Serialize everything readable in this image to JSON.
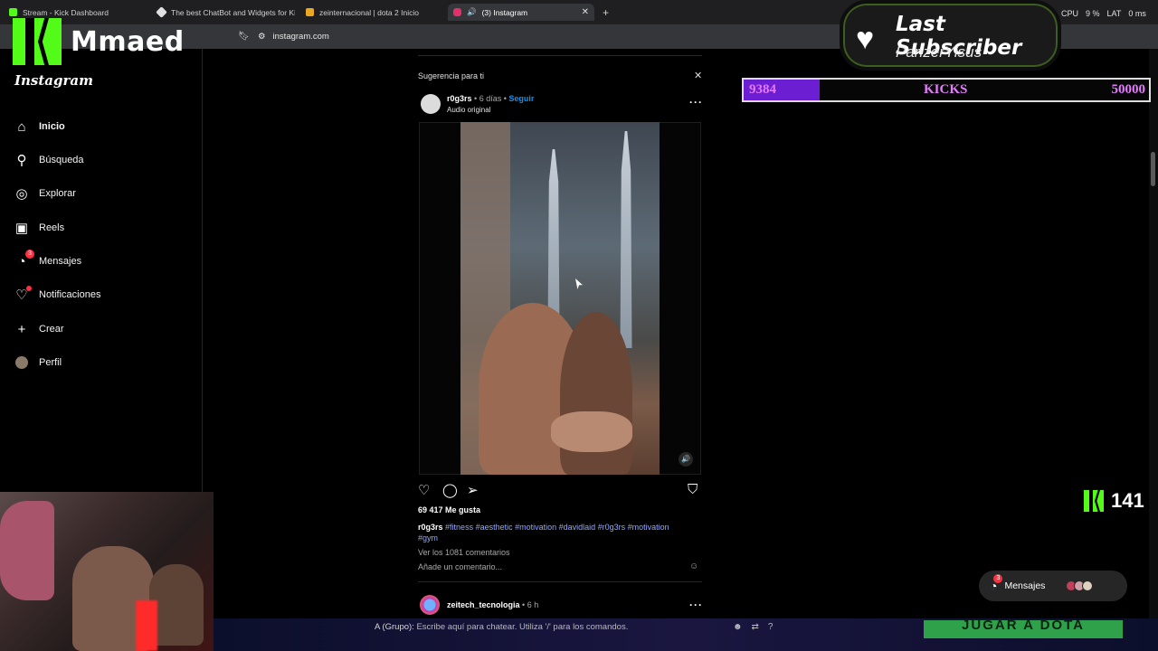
{
  "browser": {
    "tabs": [
      {
        "title": "Stream - Kick Dashboard",
        "active": false
      },
      {
        "title": "The best ChatBot and Widgets for Ki",
        "active": false
      },
      {
        "title": "zeinternacional | dota 2 Inicio",
        "active": false
      },
      {
        "title": "(3) Instagram",
        "active": true
      }
    ],
    "url": "instagram.com",
    "sys": {
      "cpu_label": "CPU",
      "cpu_value": "9 %",
      "lat_label": "LAT",
      "lat_value": "0 ms"
    }
  },
  "overlay": {
    "streamer_name": "Mmaed",
    "last_subscriber_title": "Last Subscriber",
    "last_subscriber_name": "PanzerYisus",
    "goal": {
      "current": "9384",
      "label": "KICKS",
      "target": "50000",
      "fill_fraction": 0.1877
    },
    "kick_count": "141",
    "chat_prefix": "A (Grupo):",
    "chat_placeholder": "Escribe aquí para chatear. Utiliza '/' para los comandos.",
    "banner_text": "JUGAR A DOTA",
    "brand_color": "#53fc18",
    "goal_color": "#6c1fd2"
  },
  "instagram": {
    "logo": "Instagram",
    "nav": [
      {
        "label": "Inicio",
        "icon": "home-icon",
        "bold": true
      },
      {
        "label": "Búsqueda",
        "icon": "search-icon"
      },
      {
        "label": "Explorar",
        "icon": "compass-icon"
      },
      {
        "label": "Reels",
        "icon": "reels-icon"
      },
      {
        "label": "Mensajes",
        "icon": "messenger-icon",
        "badge": "3"
      },
      {
        "label": "Notificaciones",
        "icon": "heart-icon"
      },
      {
        "label": "Crear",
        "icon": "plus-icon"
      },
      {
        "label": "Perfil",
        "icon": "avatar"
      }
    ],
    "suggestion": {
      "header": "Sugerencia para ti",
      "username": "r0g3rs",
      "time": "6 días",
      "follow": "Seguir",
      "audio": "Audio original",
      "likes": "69 417 Me gusta",
      "caption_user": "r0g3rs",
      "caption_tags": "#fitness #aesthetic #motivation #davidlaid #r0g3rs #motivation #gym",
      "view_comments": "Ver los 1081 comentarios",
      "add_comment": "Añade un comentario..."
    },
    "next_post": {
      "username": "zeitech_tecnologia",
      "time": "6 h"
    },
    "messages_button": {
      "label": "Mensajes",
      "badge": "3"
    }
  }
}
